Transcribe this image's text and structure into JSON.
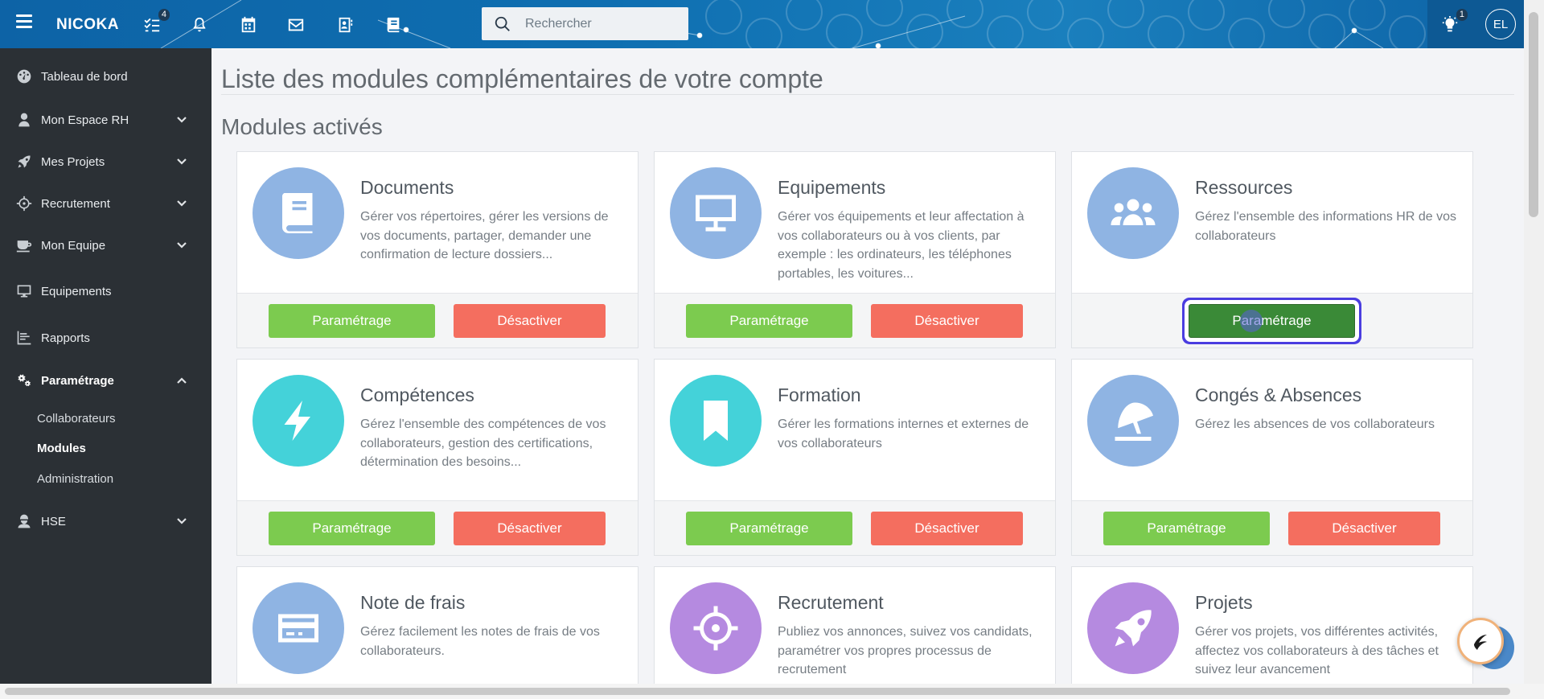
{
  "header": {
    "brand": "NICOKA",
    "tasks_badge": "4",
    "search_placeholder": "Rechercher",
    "notif_badge": "1",
    "avatar_initials": "EL"
  },
  "sidebar": {
    "items": [
      {
        "label": "Tableau de bord",
        "icon": "dashboard-icon"
      },
      {
        "label": "Mon Espace RH",
        "icon": "user-icon"
      },
      {
        "label": "Mes Projets",
        "icon": "rocket-icon"
      },
      {
        "label": "Recrutement",
        "icon": "crosshair-icon"
      },
      {
        "label": "Mon Equipe",
        "icon": "coffee-icon"
      },
      {
        "label": "Equipements",
        "icon": "monitor-icon"
      },
      {
        "label": "Rapports",
        "icon": "chart-icon"
      },
      {
        "label": "Paramétrage",
        "icon": "gears-icon"
      },
      {
        "label": "HSE",
        "icon": "worker-icon"
      }
    ],
    "sub_items": [
      "Collaborateurs",
      "Modules",
      "Administration"
    ]
  },
  "main": {
    "page_title": "Liste des modules complémentaires de votre compte",
    "section_title": "Modules activés",
    "btn_settings": "Paramétrage",
    "btn_disable": "Désactiver",
    "modules": [
      {
        "name": "Documents",
        "desc": "Gérer vos répertoires, gérer les versions de vos documents, partager, demander une confirmation de lecture dossiers...",
        "color": "#8fb4e3",
        "icon": "book-icon"
      },
      {
        "name": "Equipements",
        "desc": "Gérer vos équipements et leur affectation à vos collaborateurs ou à vos clients, par exemple : les ordinateurs, les téléphones portables, les voitures...",
        "color": "#8fb4e3",
        "icon": "monitor-icon"
      },
      {
        "name": "Ressources",
        "desc": "Gérez l'ensemble des informations HR de vos collaborateurs",
        "color": "#8fb4e3",
        "icon": "users-icon"
      },
      {
        "name": "Compétences",
        "desc": "Gérez l'ensemble des compétences de vos collaborateurs, gestion des certifications, détermination des besoins...",
        "color": "#44d2d9",
        "icon": "bolt-icon"
      },
      {
        "name": "Formation",
        "desc": "Gérer les formations internes et externes de vos collaborateurs",
        "color": "#44d2d9",
        "icon": "bookmark-icon"
      },
      {
        "name": "Congés & Absences",
        "desc": "Gérez les absences de vos collaborateurs",
        "color": "#8fb4e3",
        "icon": "umbrella-beach-icon"
      },
      {
        "name": "Note de frais",
        "desc": "Gérez facilement les notes de frais de vos collaborateurs.",
        "color": "#8fb4e3",
        "icon": "credit-card-icon"
      },
      {
        "name": "Recrutement",
        "desc": "Publiez vos annonces, suivez vos candidats, paramétrer vos propres processus de recrutement",
        "color": "#b58ae0",
        "icon": "crosshair-icon"
      },
      {
        "name": "Projets",
        "desc": "Gérer vos projets, vos différentes activités, affectez vos collaborateurs à des tâches et suivez leur avancement",
        "color": "#b58ae0",
        "icon": "rocket-icon"
      }
    ]
  }
}
